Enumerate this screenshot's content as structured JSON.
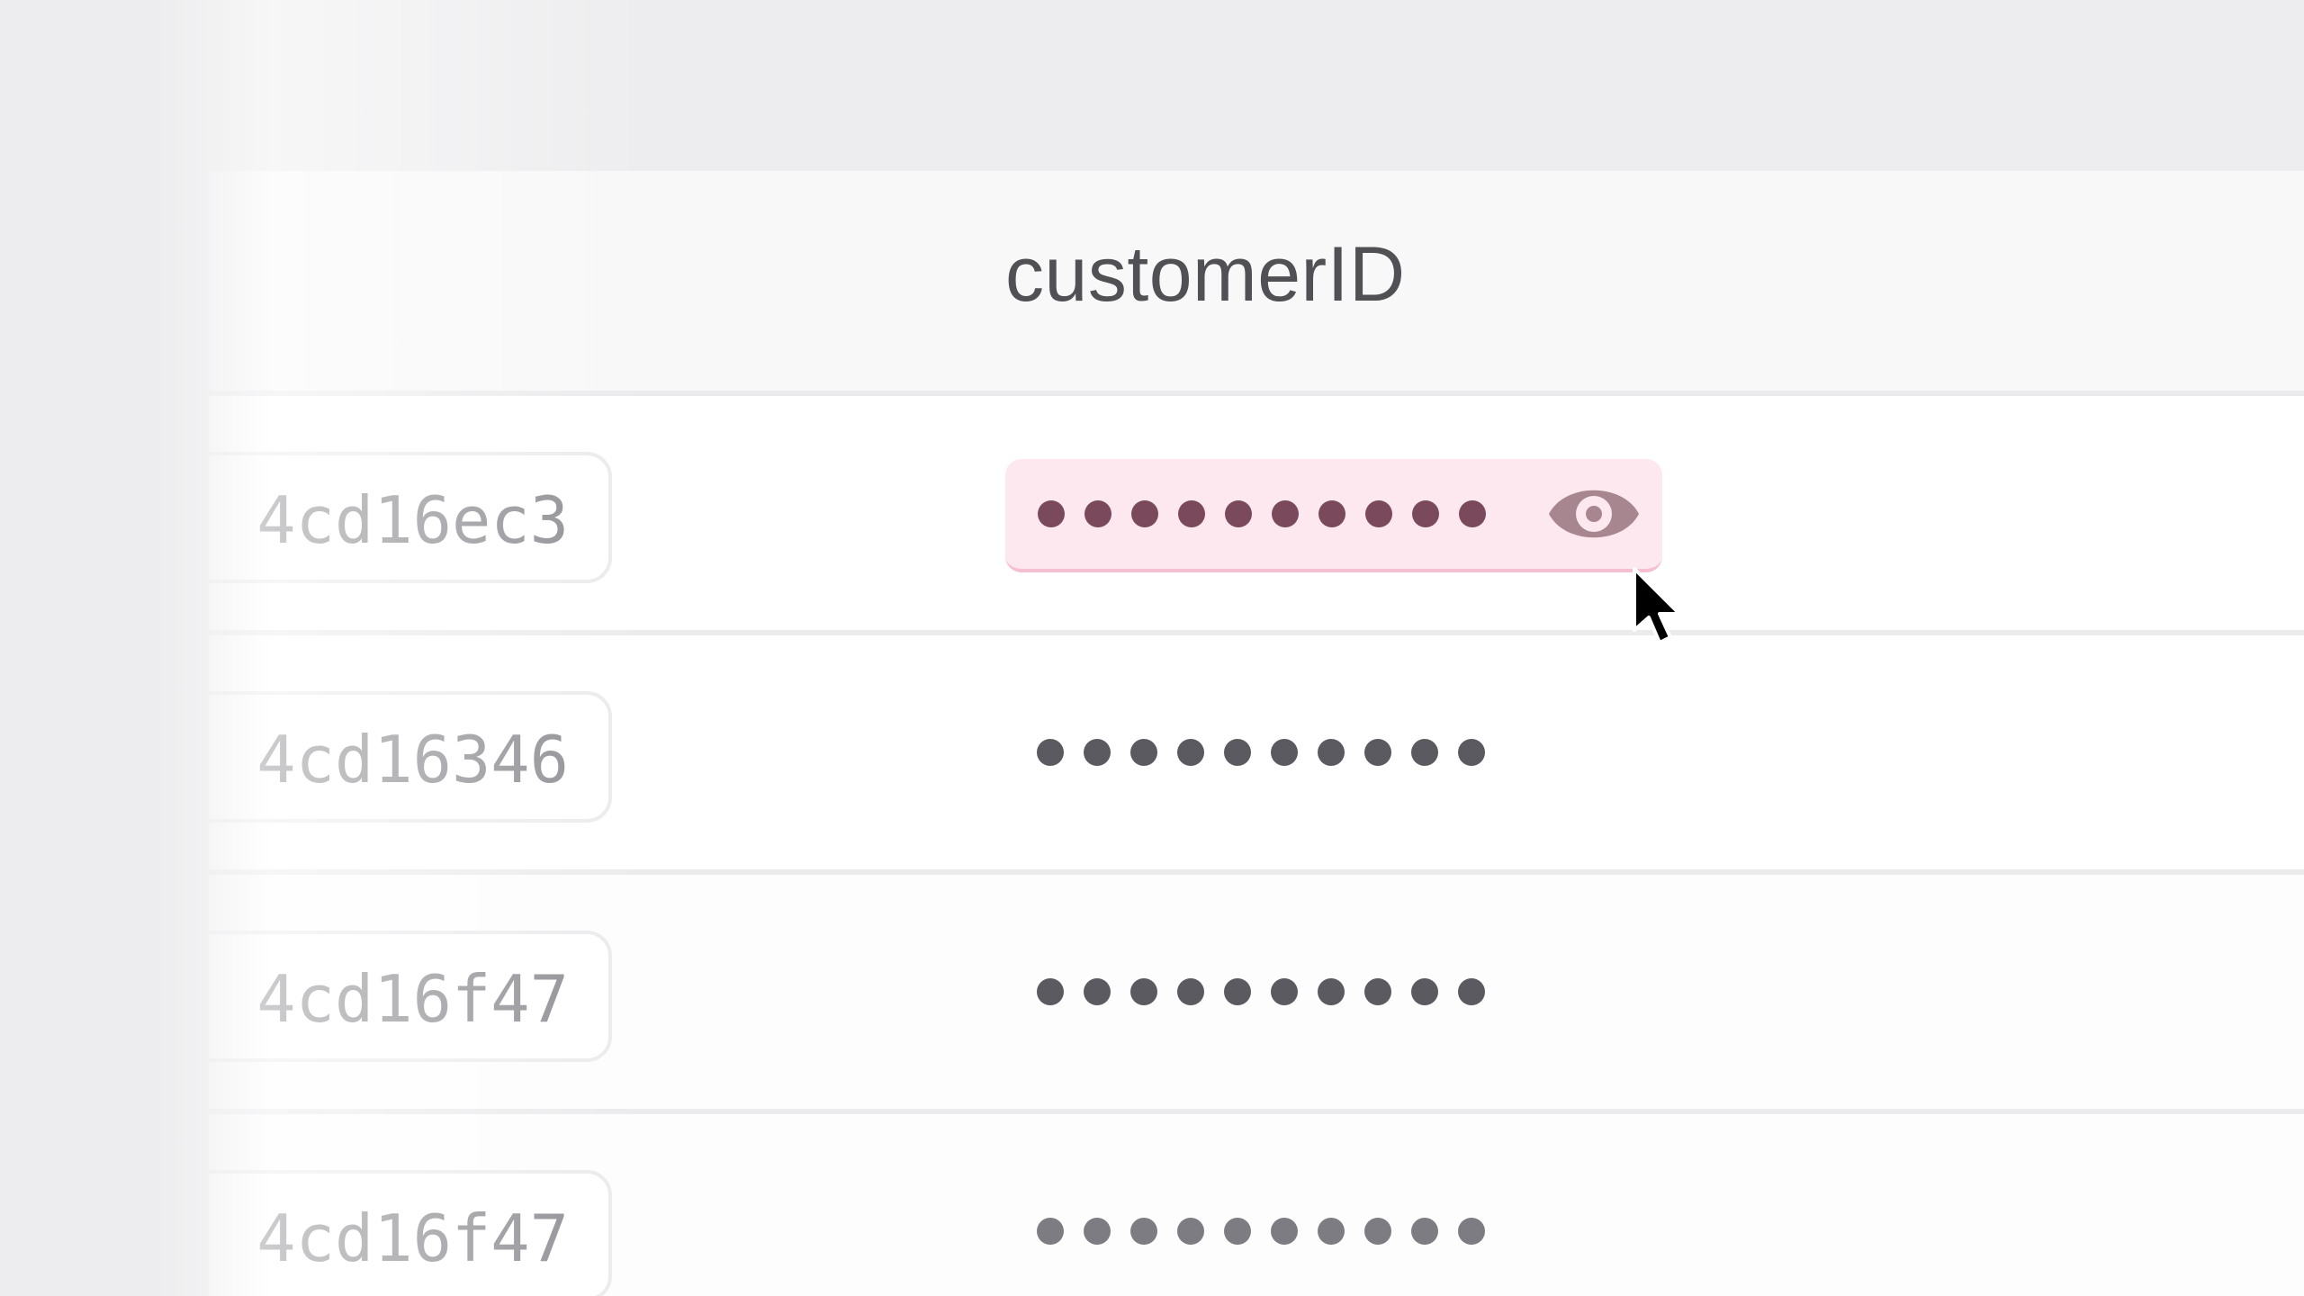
{
  "table": {
    "column_header": "customerID",
    "rows": [
      {
        "id": "4cd16ec3",
        "masked_value": "••••••••••",
        "revealed": false,
        "hovered": true
      },
      {
        "id": "4cd16346",
        "masked_value": "••••••••••",
        "revealed": false,
        "hovered": false
      },
      {
        "id": "4cd16f47",
        "masked_value": "••••••••••",
        "revealed": false,
        "hovered": false
      },
      {
        "id": "4cd16f47",
        "masked_value": "••••••••••",
        "revealed": false,
        "hovered": false
      }
    ]
  },
  "icons": {
    "reveal": "eye-icon",
    "pointer": "mouse-cursor-icon"
  },
  "colors": {
    "highlight_background": "#fde8ef",
    "highlight_underline": "#f6bfd1",
    "eye_icon": "#a8868f",
    "mask_dot": "#5a5a60",
    "mask_dot_highlight": "#7a4a5c",
    "page_background": "#ededef",
    "header_background": "#f8f8f9"
  }
}
